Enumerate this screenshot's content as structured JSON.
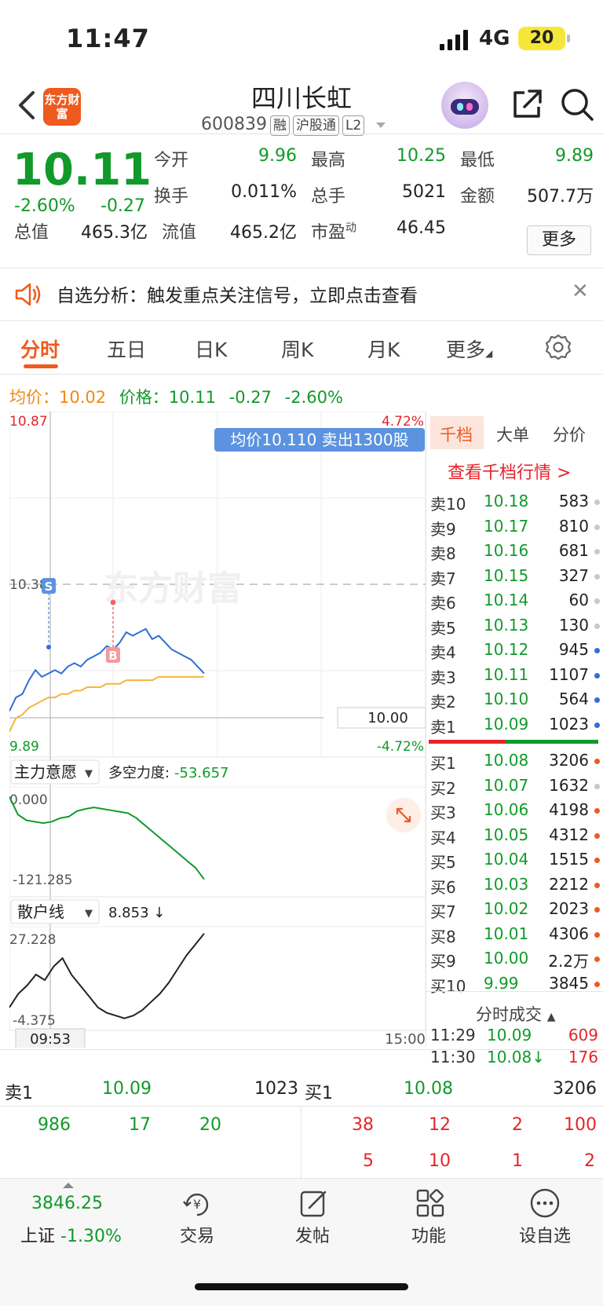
{
  "status": {
    "time": "11:47",
    "network": "4G",
    "battery": "20"
  },
  "header": {
    "name": "四川长虹",
    "code": "600839",
    "tags": [
      "融",
      "沪股通",
      "L2"
    ],
    "logo": "东方财富"
  },
  "quote": {
    "price": "10.11",
    "pct": "-2.60%",
    "change": "-0.27",
    "open_label": "今开",
    "open": "9.96",
    "high_label": "最高",
    "high": "10.25",
    "low_label": "最低",
    "low": "9.89",
    "turnover_label": "换手",
    "turnover": "0.011%",
    "volume_label": "总手",
    "volume": "5021",
    "amount_label": "金额",
    "amount": "507.7万",
    "mktcap_label": "总值",
    "mktcap": "465.3亿",
    "float_label": "流值",
    "float": "465.2亿",
    "pe_label": "市盈",
    "pe_sup": "动",
    "pe": "46.45",
    "more": "更多"
  },
  "notice": {
    "text": "自选分析：触发重点关注信号，立即点击查看"
  },
  "tabs": [
    "分时",
    "五日",
    "日K",
    "周K",
    "月K",
    "更多"
  ],
  "info": {
    "avg_label": "均价：",
    "avg": "10.02",
    "price_label": "价格：",
    "price": "10.11",
    "change": "-0.27",
    "pct": "-2.60%"
  },
  "chart": {
    "y_max": "10.87",
    "y_mid": "10.38",
    "y_min": "9.89",
    "pct_max": "4.72%",
    "pct_min": "-4.72%",
    "tooltip": "均价10.110 卖出1300股",
    "hover_price": "10.00",
    "watermark": "东方财富",
    "ind1_label": "主力意愿",
    "ind1_name": "多空力度:",
    "ind1_value": "-53.657",
    "ind1_top": "0.000",
    "ind1_bottom": "-121.285",
    "ind2_label": "散户线",
    "ind2_value": "8.853 ↓",
    "ind2_top": "27.228",
    "ind2_bottom": "-4.375",
    "time_cursor": "09:53",
    "time_end": "15:00",
    "marker_s": "S",
    "marker_b": "B",
    "price_line": [
      10.01,
      10.05,
      10.06,
      10.1,
      10.13,
      10.11,
      10.12,
      10.13,
      10.12,
      10.14,
      10.15,
      10.14,
      10.16,
      10.17,
      10.18,
      10.2,
      10.19,
      10.21,
      10.24,
      10.23,
      10.24,
      10.25,
      10.22,
      10.23,
      10.21,
      10.19,
      10.18,
      10.17,
      10.16,
      10.14,
      10.12
    ],
    "avg_line": [
      9.95,
      9.99,
      10.0,
      10.02,
      10.03,
      10.04,
      10.05,
      10.05,
      10.06,
      10.06,
      10.07,
      10.07,
      10.08,
      10.08,
      10.08,
      10.09,
      10.09,
      10.09,
      10.1,
      10.1,
      10.1,
      10.1,
      10.1,
      10.11,
      10.11,
      10.11,
      10.11,
      10.11,
      10.11,
      10.11,
      10.11
    ],
    "ind1_line": [
      -5,
      -30,
      -38,
      -40,
      -42,
      -40,
      -35,
      -33,
      -25,
      -22,
      -20,
      -22,
      -24,
      -26,
      -28,
      -35,
      -45,
      -55,
      -65,
      -75,
      -85,
      -95,
      -105,
      -121
    ],
    "ind2_line": [
      0,
      5,
      8,
      12,
      10,
      15,
      18,
      12,
      8,
      4,
      0,
      -2,
      -3,
      -4,
      -3,
      -1,
      2,
      5,
      9,
      14,
      19,
      23,
      27
    ]
  },
  "orderbook": {
    "tabs": [
      "千档",
      "大单",
      "分价"
    ],
    "link": "查看千档行情 >",
    "asks": [
      {
        "label": "卖10",
        "price": "10.18",
        "vol": "583",
        "dot": "#c8c8c8"
      },
      {
        "label": "卖9",
        "price": "10.17",
        "vol": "810",
        "dot": "#c8c8c8"
      },
      {
        "label": "卖8",
        "price": "10.16",
        "vol": "681",
        "dot": "#c8c8c8"
      },
      {
        "label": "卖7",
        "price": "10.15",
        "vol": "327",
        "dot": "#c8c8c8"
      },
      {
        "label": "卖6",
        "price": "10.14",
        "vol": "60",
        "dot": "#c8c8c8"
      },
      {
        "label": "卖5",
        "price": "10.13",
        "vol": "130",
        "dot": "#c8c8c8"
      },
      {
        "label": "卖4",
        "price": "10.12",
        "vol": "945",
        "dot": "#2f6fd6"
      },
      {
        "label": "卖3",
        "price": "10.11",
        "vol": "1107",
        "dot": "#2f6fd6"
      },
      {
        "label": "卖2",
        "price": "10.10",
        "vol": "564",
        "dot": "#2f6fd6"
      },
      {
        "label": "卖1",
        "price": "10.09",
        "vol": "1023",
        "dot": "#2f6fd6"
      }
    ],
    "bids": [
      {
        "label": "买1",
        "price": "10.08",
        "vol": "3206",
        "dot": "#ef5a1f"
      },
      {
        "label": "买2",
        "price": "10.07",
        "vol": "1632",
        "dot": "#c8c8c8"
      },
      {
        "label": "买3",
        "price": "10.06",
        "vol": "4198",
        "dot": "#ef5a1f"
      },
      {
        "label": "买4",
        "price": "10.05",
        "vol": "4312",
        "dot": "#ef5a1f"
      },
      {
        "label": "买5",
        "price": "10.04",
        "vol": "1515",
        "dot": "#ef5a1f"
      },
      {
        "label": "买6",
        "price": "10.03",
        "vol": "2212",
        "dot": "#ef5a1f"
      },
      {
        "label": "买7",
        "price": "10.02",
        "vol": "2023",
        "dot": "#ef5a1f"
      },
      {
        "label": "买8",
        "price": "10.01",
        "vol": "4306",
        "dot": "#ef5a1f"
      },
      {
        "label": "买9",
        "price": "10.00",
        "vol": "2.2万",
        "dot": "#ef5a1f"
      },
      {
        "label": "买10",
        "price": "9.99",
        "vol": "3845",
        "dot": "#ef5a1f"
      }
    ],
    "ticks_title": "分时成交",
    "ticks": [
      {
        "time": "11:29",
        "price": "10.09",
        "vol": "609"
      },
      {
        "time": "11:30",
        "price": "10.08↓",
        "vol": "176"
      }
    ]
  },
  "level1": {
    "ask_label": "卖1",
    "ask_price": "10.09",
    "ask_vol": "1023",
    "bid_label": "买1",
    "bid_price": "10.08",
    "bid_vol": "3206",
    "ask_queue": [
      "986",
      "17",
      "20"
    ],
    "bid_queue_1": [
      "38",
      "12",
      "2",
      "100"
    ],
    "bid_queue_2": [
      "5",
      "10",
      "1",
      "2"
    ]
  },
  "nav": {
    "index_value": "3846.25",
    "index_name": "上证",
    "index_pct": "-1.30%",
    "trade": "交易",
    "post": "发帖",
    "func": "功能",
    "watch": "设自选"
  }
}
